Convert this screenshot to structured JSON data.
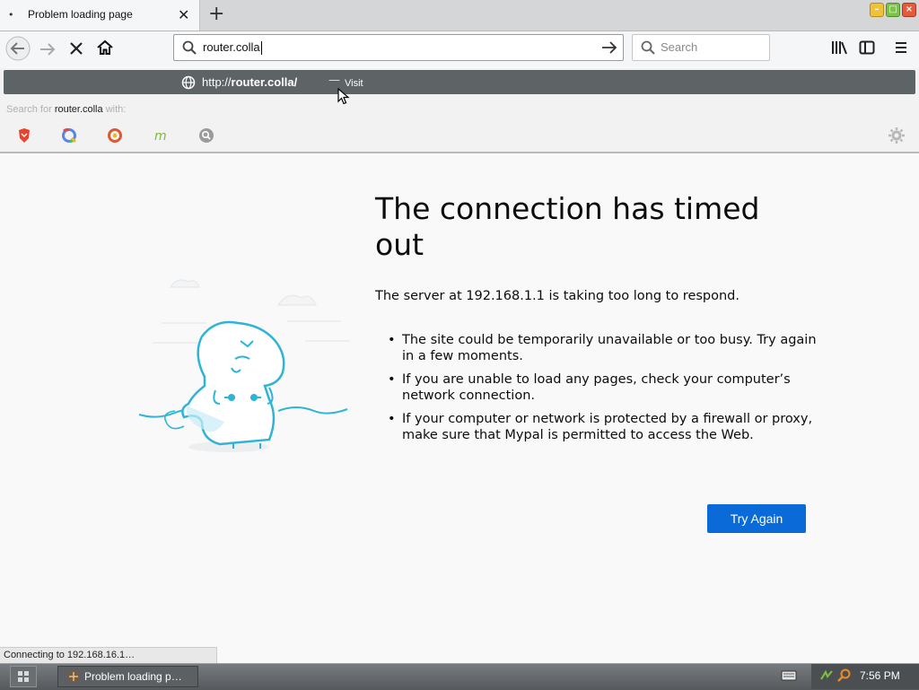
{
  "tab": {
    "title": "Problem loading page"
  },
  "navbar": {
    "url_value": "router.colla",
    "search_placeholder": "Search"
  },
  "popup": {
    "visit_url_prefix": "http://",
    "visit_url_host": "router.colla/",
    "visit_dash": "—",
    "visit_label": "Visit",
    "search_for_prefix": "Search for",
    "search_for_term": "router.colla",
    "search_for_suffix": "with:",
    "engines": [
      "brave-icon",
      "qwant-icon",
      "duckduckgo-icon",
      "mojeek-icon",
      "search-engine-icon"
    ],
    "engine_colors": [
      "#e5452f",
      "#5a84e8",
      "#de5833",
      "#7fba3a",
      "#8f8f8f"
    ]
  },
  "error": {
    "title": "The connection has timed out",
    "description": "The server at 192.168.1.1 is taking too long to respond.",
    "bullets": [
      "The site could be temporarily unavailable or too busy. Try again in a few moments.",
      "If you are unable to load any pages, check your computer’s network connection.",
      "If your computer or network is protected by a firewall or proxy, make sure that Mypal is permitted to access the Web."
    ],
    "button": "Try Again",
    "button_color": "#0a6ad8"
  },
  "status": {
    "text": "Connecting to 192.168.16.1…"
  },
  "taskbar": {
    "task_label": "Problem loading p…",
    "clock": "7:56 PM"
  }
}
